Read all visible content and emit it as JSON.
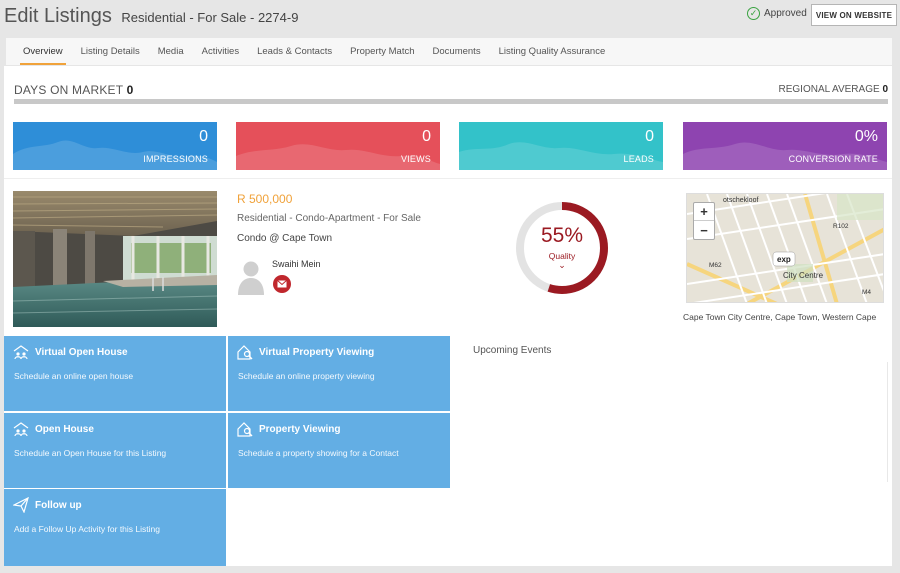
{
  "header": {
    "title": "Edit Listings",
    "subtitle": "Residential - For Sale - 2274-9",
    "status": "Approved",
    "view_website": "VIEW ON WEBSITE"
  },
  "tabs": [
    {
      "label": "Overview",
      "active": true
    },
    {
      "label": "Listing Details"
    },
    {
      "label": "Media"
    },
    {
      "label": "Activities"
    },
    {
      "label": "Leads & Contacts"
    },
    {
      "label": "Property Match"
    },
    {
      "label": "Documents"
    },
    {
      "label": "Listing Quality Assurance"
    }
  ],
  "market": {
    "days_label": "DAYS ON MARKET",
    "days_value": "0",
    "regional_label": "REGIONAL AVERAGE",
    "regional_value": "0"
  },
  "stats": [
    {
      "value": "0",
      "label": "IMPRESSIONS",
      "color": "#2e8ed8"
    },
    {
      "value": "0",
      "label": "VIEWS",
      "color": "#e5505a"
    },
    {
      "value": "0",
      "label": "LEADS",
      "color": "#33c2c9"
    },
    {
      "value": "0%",
      "label": "CONVERSION RATE",
      "color": "#8e44b0"
    }
  ],
  "listing": {
    "price": "R 500,000",
    "type": "Residential - Condo-Apartment - For Sale",
    "location": "Condo @ Cape Town",
    "agent_name": "Swaihi Mein"
  },
  "quality": {
    "percent_text": "55%",
    "percent": 55,
    "label": "Quality"
  },
  "map": {
    "address": "Cape Town City Centre, Cape Town, Western Cape",
    "zoom_in": "+",
    "zoom_out": "−",
    "labels": {
      "city": "City Centre",
      "road1": "R102",
      "road2": "M62",
      "road3": "M4",
      "top": "otschekloof",
      "brand": "exp"
    }
  },
  "actions": [
    {
      "title": "Virtual Open House",
      "desc": "Schedule an online open house"
    },
    {
      "title": "Virtual Property Viewing",
      "desc": "Schedule an online property viewing"
    },
    {
      "title": "Open House",
      "desc": "Schedule an Open House for this Listing"
    },
    {
      "title": "Property Viewing",
      "desc": "Schedule a property showing for a Contact"
    },
    {
      "title": "Follow up",
      "desc": "Add a Follow Up Activity for this Listing"
    }
  ],
  "events": {
    "title": "Upcoming Events"
  }
}
